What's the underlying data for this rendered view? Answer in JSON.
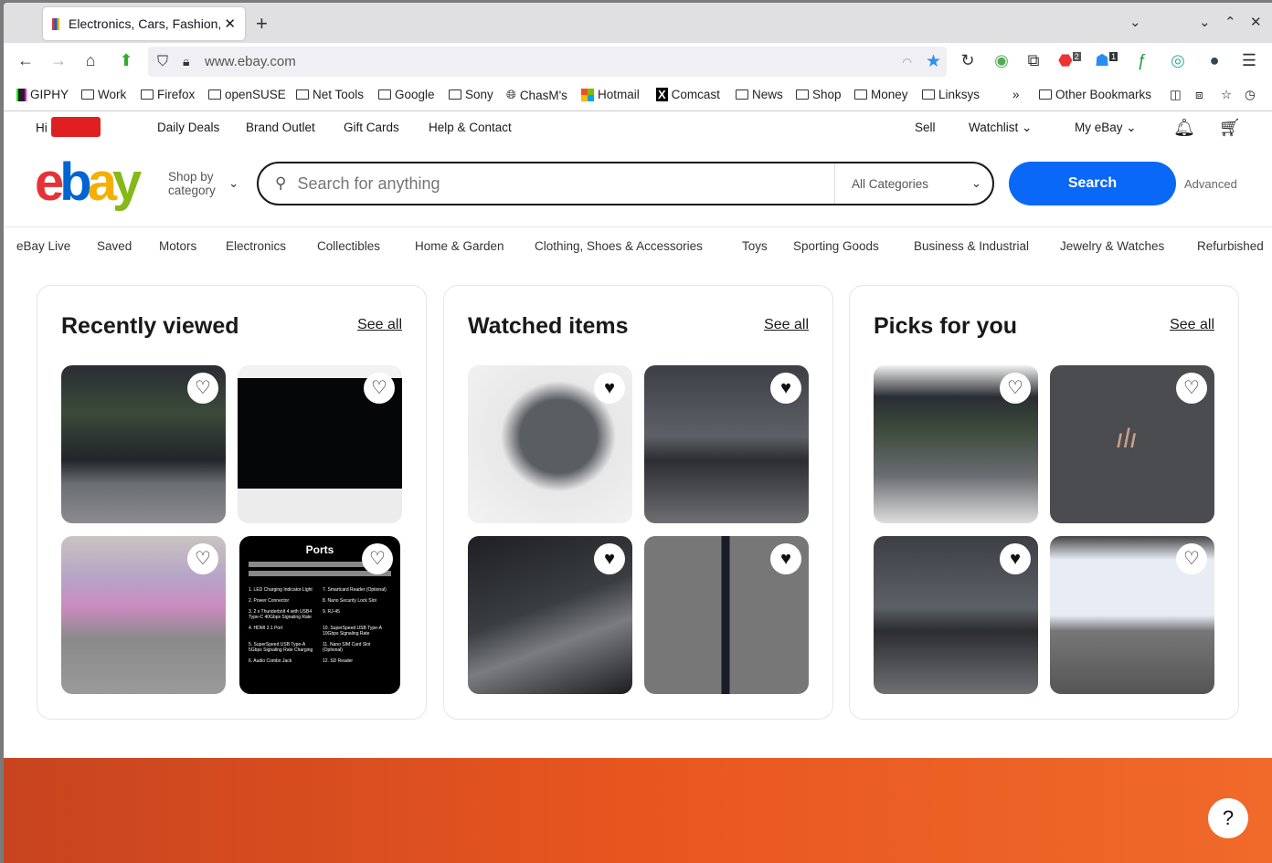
{
  "browser": {
    "tab_title": "Electronics, Cars, Fashion, Collectibles & More | eBay",
    "url": "www.ebay.com",
    "ext_badges": [
      "2",
      "1"
    ],
    "bookmarks": [
      "GIPHY",
      "Work",
      "Firefox",
      "openSUSE",
      "Net Tools",
      "Google",
      "Sony",
      "ChasM's",
      "Hotmail",
      "Comcast",
      "News",
      "Shop",
      "Money",
      "Linksys"
    ],
    "other_bookmarks": "Other Bookmarks"
  },
  "header": {
    "greeting": "Hi",
    "links": [
      "Daily Deals",
      "Brand Outlet",
      "Gift Cards",
      "Help & Contact"
    ],
    "sell": "Sell",
    "watchlist": "Watchlist",
    "my_ebay": "My eBay",
    "shop_by": "Shop by",
    "category": "category",
    "search_placeholder": "Search for anything",
    "category_select": "All Categories",
    "search_button": "Search",
    "advanced": "Advanced"
  },
  "categories": [
    "eBay Live",
    "Saved",
    "Motors",
    "Electronics",
    "Collectibles",
    "Home & Garden",
    "Clothing, Shoes & Accessories",
    "Toys",
    "Sporting Goods",
    "Business & Industrial",
    "Jewelry & Watches",
    "Refurbished"
  ],
  "sections": [
    {
      "title": "Recently viewed",
      "see_all": "See all"
    },
    {
      "title": "Watched items",
      "see_all": "See all"
    },
    {
      "title": "Picks for you",
      "see_all": "See all"
    }
  ],
  "ports_image": {
    "title": "Ports",
    "items": [
      "1. LED Charging Indicator Light",
      "7. Smartcard Reader (Optional)",
      "2. Power Connector",
      "8. Nano Security Lock Slot",
      "3. 2 x Thunderbolt 4 with USB4 Type-C 40Gbps Signaling Rate",
      "9. RJ-45",
      "4. HDMI 2.1 Port",
      "10. SuperSpeed USB Type-A 10Gbps Signaling Rate",
      "5. SuperSpeed USB Type-A 5Gbps Signaling Rate Charging",
      "11. Nano SIM Card Slot (Optional)",
      "6. Audio Combo Jack",
      "12. SD Reader"
    ]
  },
  "help": "?",
  "colors": {
    "search_blue": "#0968f6",
    "logo": [
      "#e53238",
      "#0064d2",
      "#f5af02",
      "#86b817"
    ]
  }
}
